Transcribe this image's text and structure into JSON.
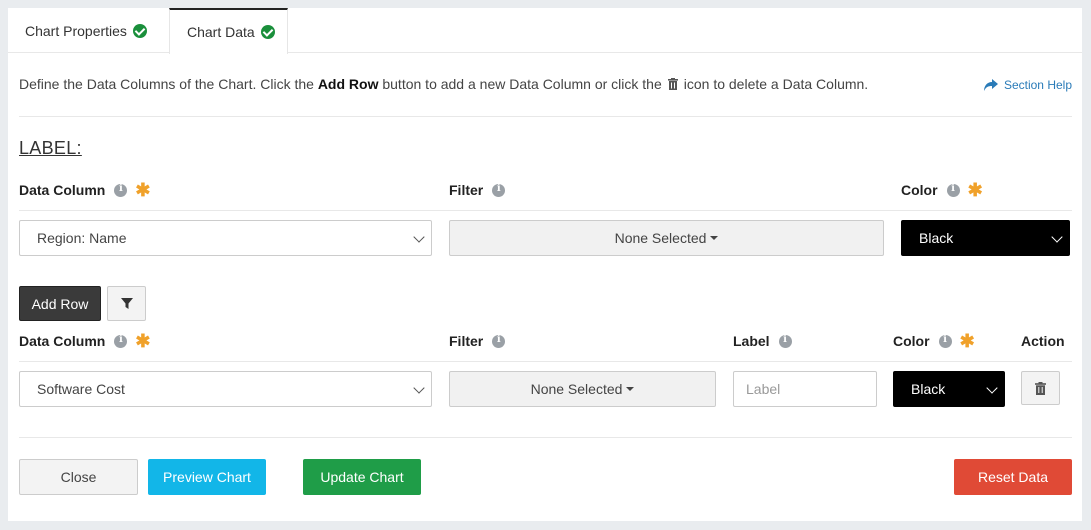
{
  "tabs": [
    {
      "label": "Chart Properties",
      "complete": true
    },
    {
      "label": "Chart Data",
      "complete": true,
      "active": true
    }
  ],
  "intro": {
    "prefix": "Define the Data Columns of the Chart. Click the",
    "bold": "Add Row",
    "middle": "button to add a new Data Column or click the",
    "suffix": "icon to delete a Data Column."
  },
  "help": {
    "label": "Section Help"
  },
  "label_section": {
    "title": "LABEL:",
    "headers": {
      "data_column": "Data Column",
      "filter": "Filter",
      "color": "Color"
    },
    "row": {
      "data_column": "Region: Name",
      "filter": "None Selected",
      "color": "Black"
    }
  },
  "buttons": {
    "add_row": "Add Row",
    "close": "Close",
    "preview": "Preview Chart",
    "update": "Update Chart",
    "reset": "Reset Data"
  },
  "data_section": {
    "headers": {
      "data_column": "Data Column",
      "filter": "Filter",
      "label": "Label",
      "color": "Color",
      "action": "Action"
    },
    "row": {
      "data_column": "Software Cost",
      "filter": "None Selected",
      "label_value": "",
      "label_placeholder": "Label",
      "color": "Black"
    }
  },
  "colors": {
    "required": "#f0a12a",
    "check": "#1a8f3b",
    "link": "#2a7bb8"
  }
}
